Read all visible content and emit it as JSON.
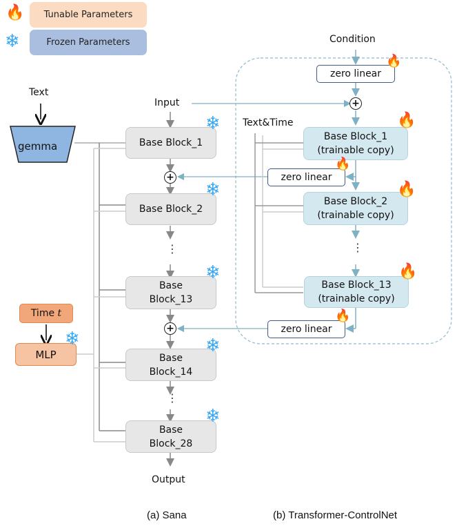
{
  "legend": {
    "tunable_label": "Tunable Parameters",
    "frozen_label": "Frozen Parameters",
    "tunable_icon": "fire-icon",
    "frozen_icon": "snowflake-icon"
  },
  "icons": {
    "fire": "🔥",
    "snowflake": "❄"
  },
  "sana": {
    "text_label": "Text",
    "encoder_label": "gemma",
    "input_label": "Input",
    "time_label": "Time",
    "time_var": "t",
    "mlp_label": "MLP",
    "blocks": [
      {
        "line1": "Base Block_1",
        "line2": ""
      },
      {
        "line1": "Base Block_2",
        "line2": ""
      },
      {
        "line1": "Base",
        "line2": "Block_13"
      },
      {
        "line1": "Base",
        "line2": "Block_14"
      },
      {
        "line1": "Base",
        "line2": "Block_28"
      }
    ],
    "output_label": "Output",
    "ellipsis": "⋮",
    "plus": "+",
    "caption": "(a) Sana"
  },
  "controlnet": {
    "condition_label": "Condition",
    "text_time_label": "Text&Time",
    "zero_linear_label": "zero linear",
    "blocks": [
      {
        "line1": "Base Block_1",
        "line2": "(trainable copy)"
      },
      {
        "line1": "Base Block_2",
        "line2": "(trainable copy)"
      },
      {
        "line1": "Base Block_13",
        "line2": "(trainable copy)"
      }
    ],
    "ellipsis": "⋮",
    "plus": "+",
    "caption": "(b) Transformer-ControlNet"
  },
  "colors": {
    "tunable_bg": "#fbdcc3",
    "frozen_bg": "#aabfe0",
    "base_block_bg": "#e7e7e7",
    "control_block_bg": "#d4e8f0",
    "gemma_bg": "#8fb6e0",
    "time_bg": "#f2a77a",
    "mlp_bg": "#f6c3a3",
    "control_arrow": "#7fb1c4",
    "dashed_border": "#8fb8cc"
  }
}
